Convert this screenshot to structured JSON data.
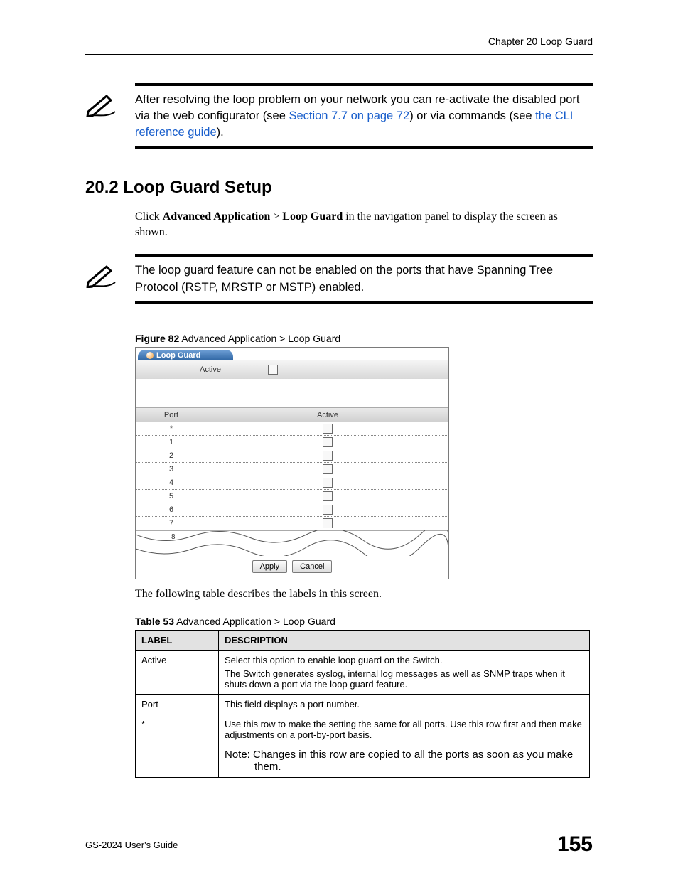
{
  "header": {
    "chapter_label": "Chapter 20 Loop Guard"
  },
  "note1": {
    "prefix": "After resolving the loop problem on your network you can re-activate the disabled port via the web configurator (see ",
    "link1": "Section 7.7 on page 72",
    "middle": ") or via commands (see ",
    "link2": "the CLI reference guide",
    "suffix": ")."
  },
  "section": {
    "number_title": "20.2  Loop Guard Setup",
    "intro_prefix": "Click ",
    "intro_b1": "Advanced Application",
    "intro_mid": " > ",
    "intro_b2": "Loop Guard",
    "intro_suffix": " in the navigation panel to display the screen as shown."
  },
  "note2": {
    "text": "The loop guard feature can not be enabled on the ports that have Spanning Tree Protocol (RSTP, MRSTP or MSTP) enabled."
  },
  "figure": {
    "caption_bold": "Figure 82",
    "caption_rest": "   Advanced Application > Loop Guard",
    "screenshot": {
      "title": "Loop Guard",
      "global_active_label": "Active",
      "col_port": "Port",
      "col_active": "Active",
      "rows": [
        "*",
        "1",
        "2",
        "3",
        "4",
        "5",
        "6",
        "7",
        "8"
      ],
      "apply_label": "Apply",
      "cancel_label": "Cancel"
    }
  },
  "table_intro": "The following table describes the labels in this screen.",
  "table": {
    "caption_bold": "Table 53",
    "caption_rest": "   Advanced Application > Loop Guard",
    "head_label": "LABEL",
    "head_desc": "DESCRIPTION",
    "rows": [
      {
        "label": "Active",
        "desc_line1": "Select this option to enable loop guard on the Switch.",
        "desc_line2": "The Switch generates syslog, internal log messages as well as SNMP traps when it shuts down a port via the loop guard feature."
      },
      {
        "label": "Port",
        "desc_line1": "This field displays a port number."
      },
      {
        "label": "*",
        "desc_line1": "Use this row to make the setting the same for all ports. Use this row first and then make adjustments on a port-by-port basis.",
        "note": "Note: Changes in this row are copied to all the ports as soon as you make them."
      }
    ]
  },
  "footer": {
    "guide": "GS-2024 User's Guide",
    "page": "155"
  }
}
